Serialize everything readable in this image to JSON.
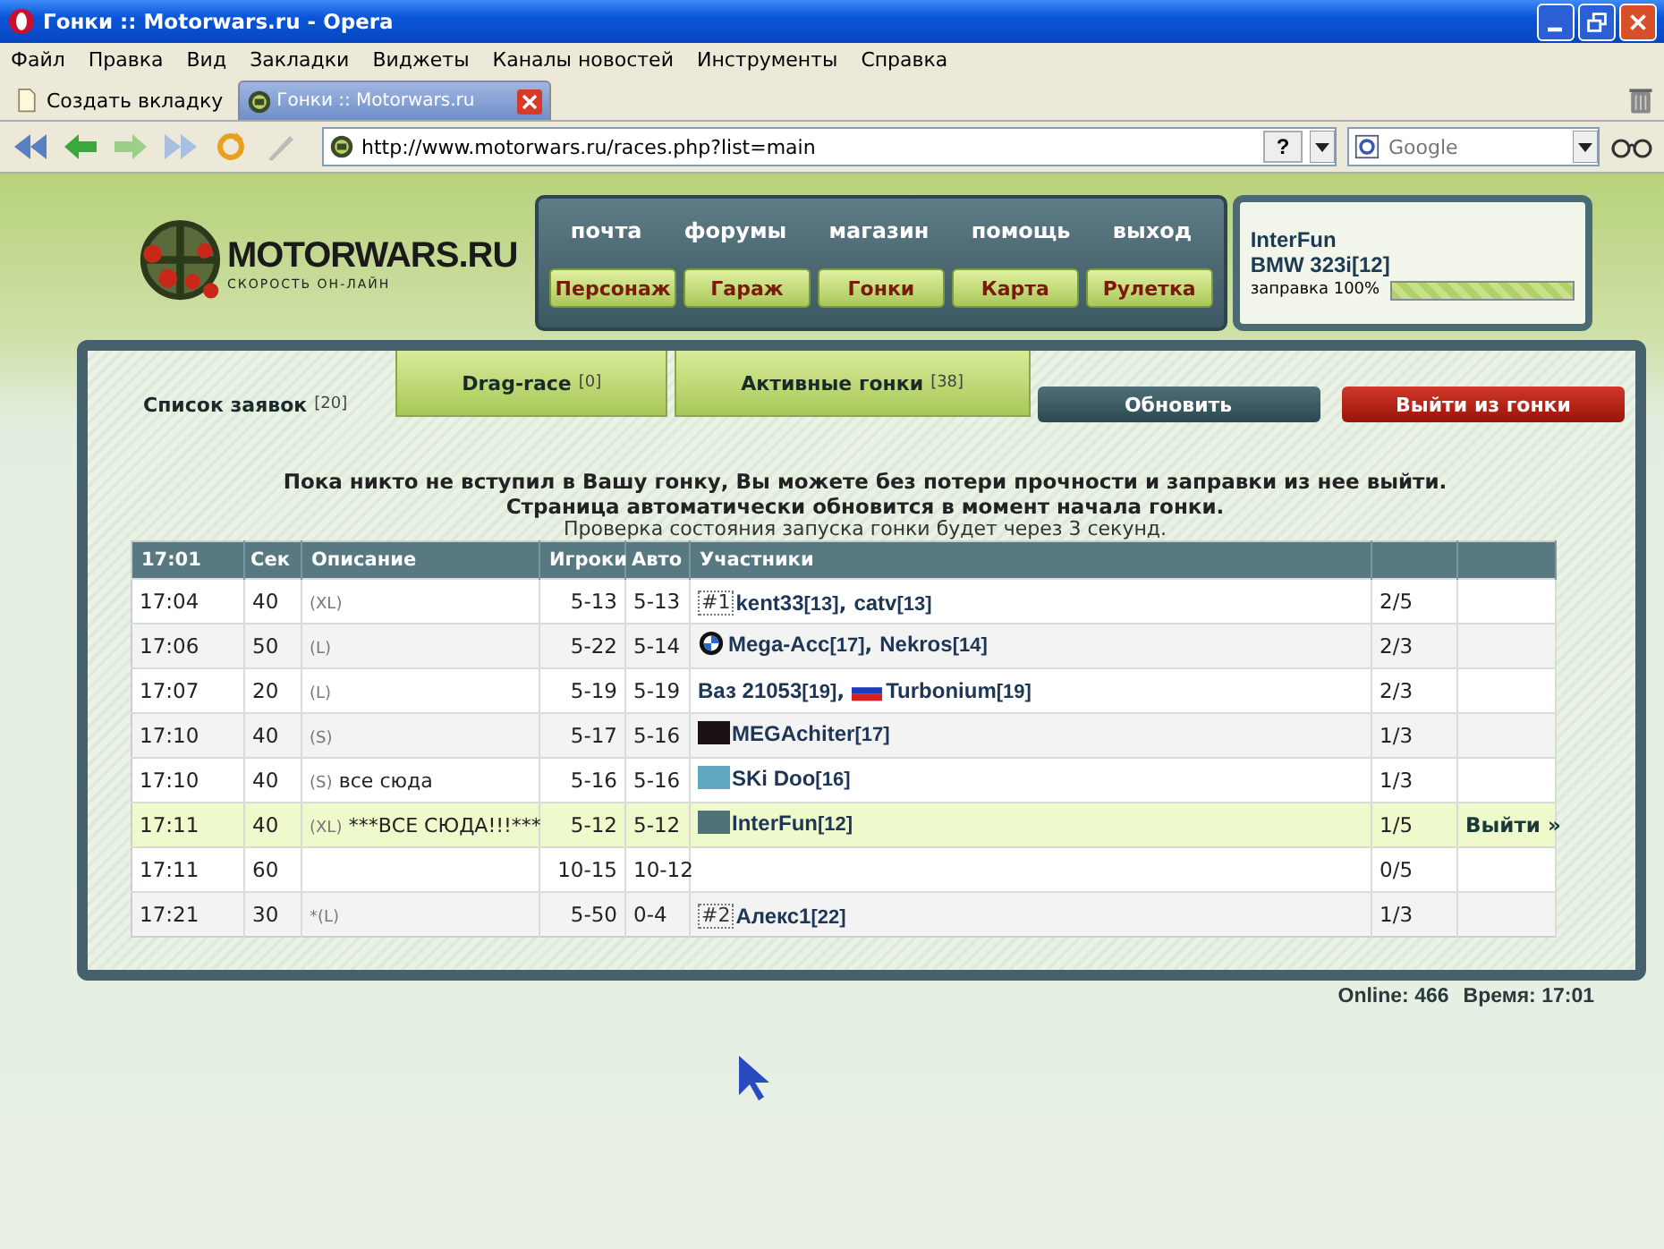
{
  "window": {
    "title": "Гонки :: Motorwars.ru - Opera"
  },
  "menu": [
    "Файл",
    "Правка",
    "Вид",
    "Закладки",
    "Виджеты",
    "Каналы новостей",
    "Инструменты",
    "Справка"
  ],
  "tabs": [
    {
      "label": "Создать вкладку",
      "kind": "new"
    },
    {
      "label": "Гонки :: Motorwars.ru",
      "kind": "page",
      "selected": true
    }
  ],
  "address": {
    "url": "http://www.motorwars.ru/races.php?list=main",
    "help": "?"
  },
  "search": {
    "placeholder": "Google"
  },
  "site": {
    "logo": "MOTORWARS.RU",
    "slogan": "СКОРОСТЬ ОН-ЛАЙН",
    "top_links": [
      "почта",
      "форумы",
      "магазин",
      "помощь",
      "выход"
    ],
    "nav_buttons": [
      "Персонаж",
      "Гараж",
      "Гонки",
      "Карта",
      "Рулетка"
    ],
    "user": {
      "name": "InterFun",
      "car": "BMW 323i[12]",
      "fuel_label": "заправка 100%",
      "level": 1.0
    }
  },
  "race_tabs": [
    {
      "label": "Список заявок",
      "count": "[20]",
      "selected": true
    },
    {
      "label": "Drag-race",
      "count": "[0]",
      "selected": false
    },
    {
      "label": "Активные гонки",
      "count": "[38]",
      "selected": false
    }
  ],
  "refresh_button": "Обновить",
  "leave_button": "Выйти из гонки",
  "notice": [
    "Пока никто не вступил в Вашу гонку, Вы можете без потери прочности и заправки из нее выйти.",
    "Страница автоматически обновится в момент начала гонки."
  ],
  "check_note": "Проверка состояния запуска гонки будет через 3 секунд.",
  "table": {
    "columns": [
      "17:01",
      "Сек",
      "Описание",
      "Игроки",
      "Авто",
      "Участники"
    ],
    "rows": [
      {
        "time": "17:04",
        "sec": "40",
        "size": "(XL)",
        "players": "5-13",
        "auto": "5-13",
        "participants": [
          {
            "kind": "badge",
            "badge": "#1",
            "name": "kent33",
            "level": "[13]",
            "suffix": ","
          },
          {
            "kind": "plain",
            "name": "catv",
            "level": "[13]"
          }
        ],
        "count": "2/5",
        "selected": false
      },
      {
        "time": "17:06",
        "sec": "50",
        "size": "(L)",
        "players": "5-22",
        "auto": "5-14",
        "participants": [
          {
            "kind": "emblem",
            "name": "Mega-Acc",
            "level": "[17]",
            "suffix": ","
          },
          {
            "kind": "plain",
            "name": "Nekros",
            "level": "[14]"
          }
        ],
        "count": "2/3",
        "selected": false
      },
      {
        "time": "17:07",
        "sec": "20",
        "size": "(L)",
        "players": "5-19",
        "auto": "5-19",
        "participants": [
          {
            "kind": "plain",
            "name": "Ваз 21053",
            "level": "[19]",
            "suffix": ","
          },
          {
            "kind": "flag",
            "name": "Turbonium",
            "level": "[19]"
          }
        ],
        "count": "2/3",
        "selected": false
      },
      {
        "time": "17:10",
        "sec": "40",
        "size": "(S)",
        "players": "5-17",
        "auto": "5-16",
        "participants": [
          {
            "kind": "avatar",
            "color": "#1a1212",
            "name": "MEGAchiter",
            "level": "[17]"
          }
        ],
        "count": "1/3",
        "selected": false
      },
      {
        "time": "17:10",
        "sec": "40",
        "size": "(S)",
        "desc": "все сюда",
        "players": "5-16",
        "auto": "5-16",
        "participants": [
          {
            "kind": "avatar",
            "color": "#5fa8c0",
            "name": "SKi Doo",
            "level": "[16]"
          }
        ],
        "count": "1/3",
        "selected": false
      },
      {
        "time": "17:11",
        "sec": "40",
        "size": "(XL)",
        "desc": "***ВСЕ СЮДА!!!***",
        "players": "5-12",
        "auto": "5-12",
        "participants": [
          {
            "kind": "avatar",
            "color": "#4f7078",
            "name": "InterFun",
            "level": "[12]"
          }
        ],
        "count": "1/5",
        "action": "Выйти »",
        "selected": true
      },
      {
        "time": "17:11",
        "sec": "60",
        "players": "10-15",
        "auto": "10-12",
        "count": "0/5",
        "selected": false
      },
      {
        "time": "17:21",
        "sec": "30",
        "size": "*(L)",
        "players": "5-50",
        "auto": "0-4",
        "participants": [
          {
            "kind": "badge",
            "badge": "#2",
            "name": "Алекс1",
            "level": "[22]"
          }
        ],
        "count": "1/3",
        "selected": false
      }
    ]
  },
  "status": {
    "online": "Online: 466",
    "time": "Время: 17:01"
  }
}
